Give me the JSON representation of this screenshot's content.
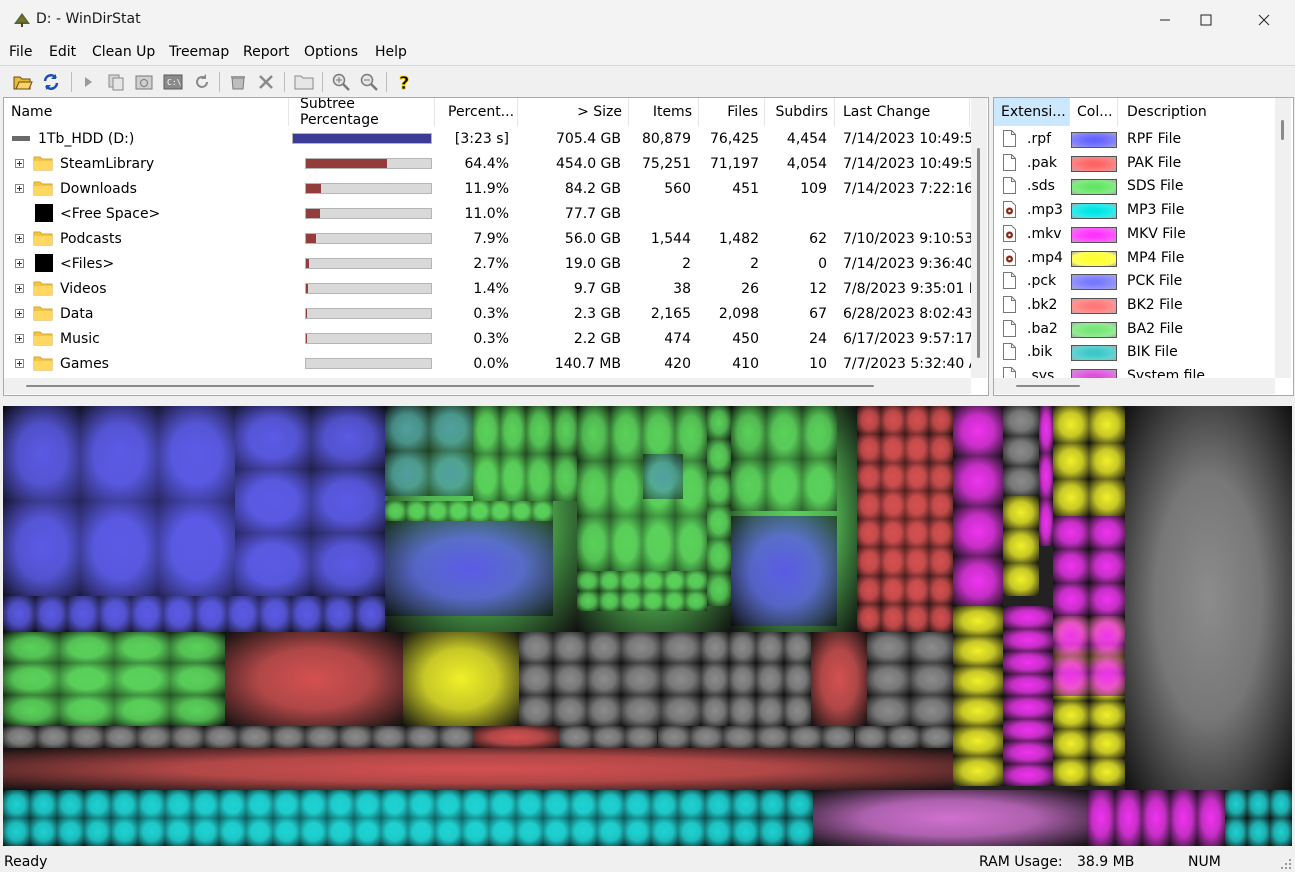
{
  "window": {
    "title": "D: - WinDirStat"
  },
  "menu": [
    "File",
    "Edit",
    "Clean Up",
    "Treemap",
    "Report",
    "Options",
    "Help"
  ],
  "columns": {
    "name": "Name",
    "subtree": "Subtree Percentage",
    "percent": "Percent...",
    "size": "> Size",
    "items": "Items",
    "files": "Files",
    "subdirs": "Subdirs",
    "lastchange": "Last Change"
  },
  "rows": [
    {
      "name": "1Tb_HDD (D:)",
      "pct": "[3:23 s]",
      "size": "705.4 GB",
      "items": "80,879",
      "files": "76,425",
      "subdirs": "4,454",
      "last": "7/14/2023 10:49:5.",
      "bar": 1.0,
      "color": "#3c3c96"
    },
    {
      "name": "SteamLibrary",
      "pct": "64.4%",
      "size": "454.0 GB",
      "items": "75,251",
      "files": "71,197",
      "subdirs": "4,054",
      "last": "7/14/2023 10:49:5.",
      "bar": 0.644,
      "color": "#943c3c"
    },
    {
      "name": "Downloads",
      "pct": "11.9%",
      "size": "84.2 GB",
      "items": "560",
      "files": "451",
      "subdirs": "109",
      "last": "7/14/2023 7:22:16",
      "bar": 0.119,
      "color": "#943c3c"
    },
    {
      "name": "<Free Space>",
      "pct": "11.0%",
      "size": "77.7 GB",
      "items": "",
      "files": "",
      "subdirs": "",
      "last": "",
      "bar": 0.11,
      "color": "#943c3c"
    },
    {
      "name": "Podcasts",
      "pct": "7.9%",
      "size": "56.0 GB",
      "items": "1,544",
      "files": "1,482",
      "subdirs": "62",
      "last": "7/10/2023 9:10:53",
      "bar": 0.079,
      "color": "#943c3c"
    },
    {
      "name": "<Files>",
      "pct": "2.7%",
      "size": "19.0 GB",
      "items": "2",
      "files": "2",
      "subdirs": "0",
      "last": "7/14/2023 9:36:40",
      "bar": 0.027,
      "color": "#943c3c"
    },
    {
      "name": "Videos",
      "pct": "1.4%",
      "size": "9.7 GB",
      "items": "38",
      "files": "26",
      "subdirs": "12",
      "last": "7/8/2023 9:35:01 P",
      "bar": 0.014,
      "color": "#943c3c"
    },
    {
      "name": "Data",
      "pct": "0.3%",
      "size": "2.3 GB",
      "items": "2,165",
      "files": "2,098",
      "subdirs": "67",
      "last": "6/28/2023 8:02:43",
      "bar": 0.003,
      "color": "#943c3c"
    },
    {
      "name": "Music",
      "pct": "0.3%",
      "size": "2.2 GB",
      "items": "474",
      "files": "450",
      "subdirs": "24",
      "last": "6/17/2023 9:57:17",
      "bar": 0.003,
      "color": "#943c3c"
    },
    {
      "name": "Games",
      "pct": "0.0%",
      "size": "140.7 MB",
      "items": "420",
      "files": "410",
      "subdirs": "10",
      "last": "7/7/2023 5:32:40 A",
      "bar": 0.0,
      "color": "#943c3c"
    }
  ],
  "ext_columns": {
    "ext": "Extensi...",
    "color": "Col...",
    "desc": "Description"
  },
  "extensions": [
    {
      "ext": ".rpf",
      "desc": "RPF File",
      "color": "#6464ff",
      "icon": "blank-file"
    },
    {
      "ext": ".pak",
      "desc": "PAK File",
      "color": "#ff6464",
      "icon": "blank-file"
    },
    {
      "ext": ".sds",
      "desc": "SDS File",
      "color": "#64e664",
      "icon": "blank-file"
    },
    {
      "ext": ".mp3",
      "desc": "MP3 File",
      "color": "#00e6e6",
      "icon": "media-file"
    },
    {
      "ext": ".mkv",
      "desc": "MKV File",
      "color": "#ff32ff",
      "icon": "media-file"
    },
    {
      "ext": ".mp4",
      "desc": "MP4 File",
      "color": "#ffff32",
      "icon": "media-file"
    },
    {
      "ext": ".pck",
      "desc": "PCK File",
      "color": "#7878ff",
      "icon": "blank-file"
    },
    {
      "ext": ".bk2",
      "desc": "BK2 File",
      "color": "#ff7878",
      "icon": "blank-file"
    },
    {
      "ext": ".ba2",
      "desc": "BA2 File",
      "color": "#78e678",
      "icon": "blank-file"
    },
    {
      "ext": ".bik",
      "desc": "BIK File",
      "color": "#3cc8c8",
      "icon": "blank-file"
    },
    {
      "ext": ".sys",
      "desc": "System file",
      "color": "#dc50dc",
      "icon": "blank-file"
    }
  ],
  "status": {
    "left": "Ready",
    "ram_label": "RAM Usage:",
    "ram_value": "38.9 MB",
    "num": "NUM"
  },
  "toolbar_icons": [
    "open-icon",
    "refresh-icon",
    "play-icon",
    "copy-path-icon",
    "explorer-icon",
    "command-prompt-icon",
    "refresh-selected-icon",
    "recycle-icon",
    "delete-icon",
    "new-folder-icon",
    "zoom-in-icon",
    "zoom-out-icon",
    "help-icon"
  ]
}
